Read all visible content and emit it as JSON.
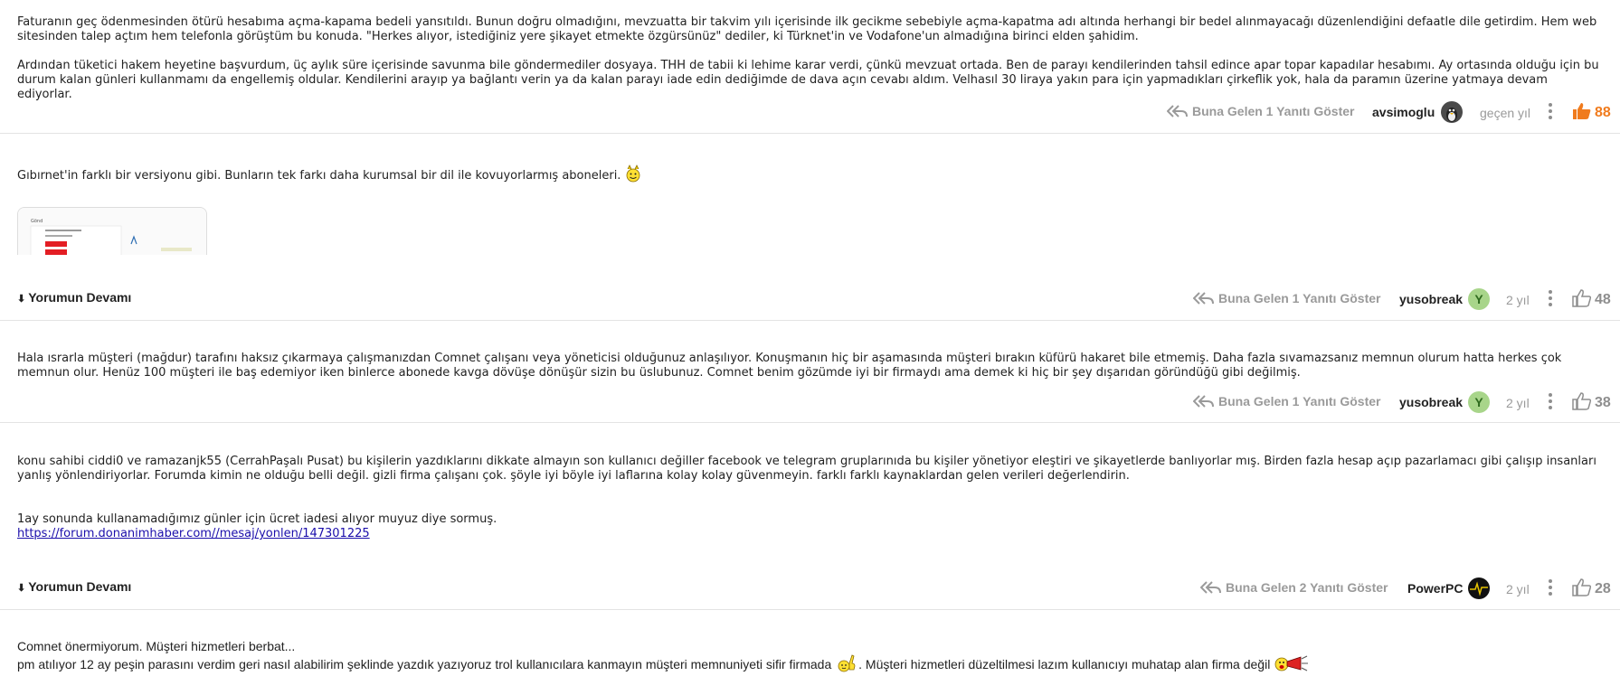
{
  "comments": [
    {
      "paragraphs": [
        "Faturanın geç ödenmesinden ötürü hesabıma açma-kapama bedeli yansıtıldı. Bunun doğru olmadığını, mevzuatta bir takvim yılı içerisinde ilk gecikme sebebiyle açma-kapatma adı altında herhangi bir bedel alınmayacağı düzenlendiğini defaatle dile getirdim. Hem web sitesinden talep açtım hem telefonla görüştüm bu konuda. \"Herkes alıyor, istediğiniz yere şikayet etmekte özgürsünüz\" dediler, ki Türknet'in ve Vodafone'un almadığına birinci elden şahidim.",
        "Ardından tüketici hakem heyetine başvurdum, üç aylık süre içerisinde savunma bile göndermediler dosyaya. THH de tabii ki lehime karar verdi, çünkü mevzuat ortada. Ben de parayı kendilerinden tahsil edince apar topar kapadılar hesabımı. Ay ortasında olduğu için bu durum kalan günleri kullanmamı da engellemiş oldular. Kendilerini arayıp ya bağlantı verin ya da kalan parayı iade edin dediğimde de dava açın cevabı aldım. Velhasıl 30 liraya yakın para için yapmadıkları çirkeflik yok, hala da paramın üzerine yatmaya devam ediyorlar."
      ],
      "replies_label": "Buna Gelen 1 Yanıtı Göster",
      "author": "avsimoglu",
      "time": "geçen yıl",
      "likes": "88"
    },
    {
      "paragraphs": [
        "Gıbırnet'in farklı bir versiyonu gibi. Bunların tek farkı daha kurumsal bir dil ile kovuyorlarmış aboneleri."
      ],
      "more_label": "Yorumun Devamı",
      "replies_label": "Buna Gelen 1 Yanıtı Göster",
      "author": "yusobreak",
      "avatar_letter": "Y",
      "time": "2 yıl",
      "likes": "48"
    },
    {
      "paragraphs": [
        "Hala ısrarla müşteri (mağdur) tarafını haksız çıkarmaya çalışmanızdan Comnet çalışanı veya yöneticisi olduğunuz anlaşılıyor. Konuşmanın hiç bir aşamasında müşteri bırakın küfürü hakaret bile etmemiş. Daha fazla sıvamazsanız memnun olurum hatta herkes çok memnun olur. Henüz 100 müşteri ile baş edemiyor iken binlerce abonede kavga dövüşe dönüşür sizin bu üslubunuz. Comnet benim gözümde iyi bir firmaydı ama demek ki hiç bir şey dışarıdan göründüğü gibi değilmiş."
      ],
      "replies_label": "Buna Gelen 1 Yanıtı Göster",
      "author": "yusobreak",
      "avatar_letter": "Y",
      "time": "2 yıl",
      "likes": "38"
    },
    {
      "paragraphs": [
        "konu sahibi ciddi0 ve ramazanjk55 (CerrahPaşalı Pusat) bu kişilerin yazdıklarını dikkate almayın son kullanıcı değiller facebook ve telegram gruplarınıda bu kişiler yönetiyor eleştiri ve şikayetlerde banlıyorlar mış. Birden fazla hesap açıp pazarlamacı gibi çalışıp insanları yanlış yönlendiriyorlar. Forumda kimin ne olduğu belli değil. gizli firma çalışanı çok. şöyle iyi böyle iyi laflarına kolay kolay güvenmeyin. farklı farklı kaynaklardan gelen verileri değerlendirin.",
        "1ay sonunda kullanamadığımız günler için ücret iadesi alıyor muyuz diye sormuş."
      ],
      "link": "https://forum.donanimhaber.com//mesaj/yonlen/147301225",
      "more_label": "Yorumun Devamı",
      "replies_label": "Buna Gelen 2 Yanıtı Göster",
      "author": "PowerPC",
      "time": "2 yıl",
      "likes": "28"
    },
    {
      "line1": "Comnet önermiyorum. Müşteri hizmetleri berbat...",
      "line2a": "pm atılıyor 12 ay peşin parasını verdim geri nasıl alabilirim şeklinde yazdık yazıyoruz trol kullanıcılara kanmayın müşteri memnuniyeti sifir firmada",
      "line2b": ". Müşteri hizmetleri düzeltilmesi lazım kullanıcıyı muhatap alan firma değil"
    }
  ],
  "colors": {
    "accent": "#f07b1d",
    "muted": "#9a9a9a",
    "avatar_green": "#a8d58a"
  }
}
